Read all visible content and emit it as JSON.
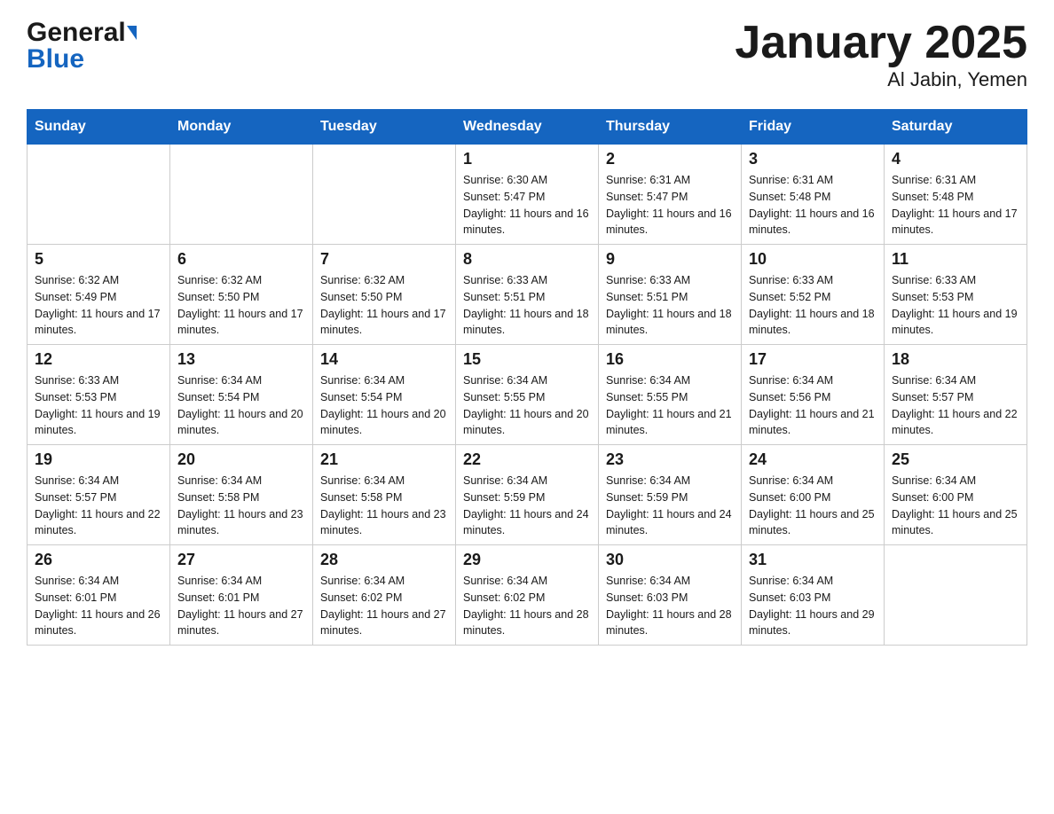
{
  "header": {
    "title": "January 2025",
    "subtitle": "Al Jabin, Yemen",
    "logo_general": "General",
    "logo_blue": "Blue"
  },
  "days_of_week": [
    "Sunday",
    "Monday",
    "Tuesday",
    "Wednesday",
    "Thursday",
    "Friday",
    "Saturday"
  ],
  "weeks": [
    {
      "days": [
        {
          "number": "",
          "info": ""
        },
        {
          "number": "",
          "info": ""
        },
        {
          "number": "",
          "info": ""
        },
        {
          "number": "1",
          "info": "Sunrise: 6:30 AM\nSunset: 5:47 PM\nDaylight: 11 hours and 16 minutes."
        },
        {
          "number": "2",
          "info": "Sunrise: 6:31 AM\nSunset: 5:47 PM\nDaylight: 11 hours and 16 minutes."
        },
        {
          "number": "3",
          "info": "Sunrise: 6:31 AM\nSunset: 5:48 PM\nDaylight: 11 hours and 16 minutes."
        },
        {
          "number": "4",
          "info": "Sunrise: 6:31 AM\nSunset: 5:48 PM\nDaylight: 11 hours and 17 minutes."
        }
      ]
    },
    {
      "days": [
        {
          "number": "5",
          "info": "Sunrise: 6:32 AM\nSunset: 5:49 PM\nDaylight: 11 hours and 17 minutes."
        },
        {
          "number": "6",
          "info": "Sunrise: 6:32 AM\nSunset: 5:50 PM\nDaylight: 11 hours and 17 minutes."
        },
        {
          "number": "7",
          "info": "Sunrise: 6:32 AM\nSunset: 5:50 PM\nDaylight: 11 hours and 17 minutes."
        },
        {
          "number": "8",
          "info": "Sunrise: 6:33 AM\nSunset: 5:51 PM\nDaylight: 11 hours and 18 minutes."
        },
        {
          "number": "9",
          "info": "Sunrise: 6:33 AM\nSunset: 5:51 PM\nDaylight: 11 hours and 18 minutes."
        },
        {
          "number": "10",
          "info": "Sunrise: 6:33 AM\nSunset: 5:52 PM\nDaylight: 11 hours and 18 minutes."
        },
        {
          "number": "11",
          "info": "Sunrise: 6:33 AM\nSunset: 5:53 PM\nDaylight: 11 hours and 19 minutes."
        }
      ]
    },
    {
      "days": [
        {
          "number": "12",
          "info": "Sunrise: 6:33 AM\nSunset: 5:53 PM\nDaylight: 11 hours and 19 minutes."
        },
        {
          "number": "13",
          "info": "Sunrise: 6:34 AM\nSunset: 5:54 PM\nDaylight: 11 hours and 20 minutes."
        },
        {
          "number": "14",
          "info": "Sunrise: 6:34 AM\nSunset: 5:54 PM\nDaylight: 11 hours and 20 minutes."
        },
        {
          "number": "15",
          "info": "Sunrise: 6:34 AM\nSunset: 5:55 PM\nDaylight: 11 hours and 20 minutes."
        },
        {
          "number": "16",
          "info": "Sunrise: 6:34 AM\nSunset: 5:55 PM\nDaylight: 11 hours and 21 minutes."
        },
        {
          "number": "17",
          "info": "Sunrise: 6:34 AM\nSunset: 5:56 PM\nDaylight: 11 hours and 21 minutes."
        },
        {
          "number": "18",
          "info": "Sunrise: 6:34 AM\nSunset: 5:57 PM\nDaylight: 11 hours and 22 minutes."
        }
      ]
    },
    {
      "days": [
        {
          "number": "19",
          "info": "Sunrise: 6:34 AM\nSunset: 5:57 PM\nDaylight: 11 hours and 22 minutes."
        },
        {
          "number": "20",
          "info": "Sunrise: 6:34 AM\nSunset: 5:58 PM\nDaylight: 11 hours and 23 minutes."
        },
        {
          "number": "21",
          "info": "Sunrise: 6:34 AM\nSunset: 5:58 PM\nDaylight: 11 hours and 23 minutes."
        },
        {
          "number": "22",
          "info": "Sunrise: 6:34 AM\nSunset: 5:59 PM\nDaylight: 11 hours and 24 minutes."
        },
        {
          "number": "23",
          "info": "Sunrise: 6:34 AM\nSunset: 5:59 PM\nDaylight: 11 hours and 24 minutes."
        },
        {
          "number": "24",
          "info": "Sunrise: 6:34 AM\nSunset: 6:00 PM\nDaylight: 11 hours and 25 minutes."
        },
        {
          "number": "25",
          "info": "Sunrise: 6:34 AM\nSunset: 6:00 PM\nDaylight: 11 hours and 25 minutes."
        }
      ]
    },
    {
      "days": [
        {
          "number": "26",
          "info": "Sunrise: 6:34 AM\nSunset: 6:01 PM\nDaylight: 11 hours and 26 minutes."
        },
        {
          "number": "27",
          "info": "Sunrise: 6:34 AM\nSunset: 6:01 PM\nDaylight: 11 hours and 27 minutes."
        },
        {
          "number": "28",
          "info": "Sunrise: 6:34 AM\nSunset: 6:02 PM\nDaylight: 11 hours and 27 minutes."
        },
        {
          "number": "29",
          "info": "Sunrise: 6:34 AM\nSunset: 6:02 PM\nDaylight: 11 hours and 28 minutes."
        },
        {
          "number": "30",
          "info": "Sunrise: 6:34 AM\nSunset: 6:03 PM\nDaylight: 11 hours and 28 minutes."
        },
        {
          "number": "31",
          "info": "Sunrise: 6:34 AM\nSunset: 6:03 PM\nDaylight: 11 hours and 29 minutes."
        },
        {
          "number": "",
          "info": ""
        }
      ]
    }
  ]
}
